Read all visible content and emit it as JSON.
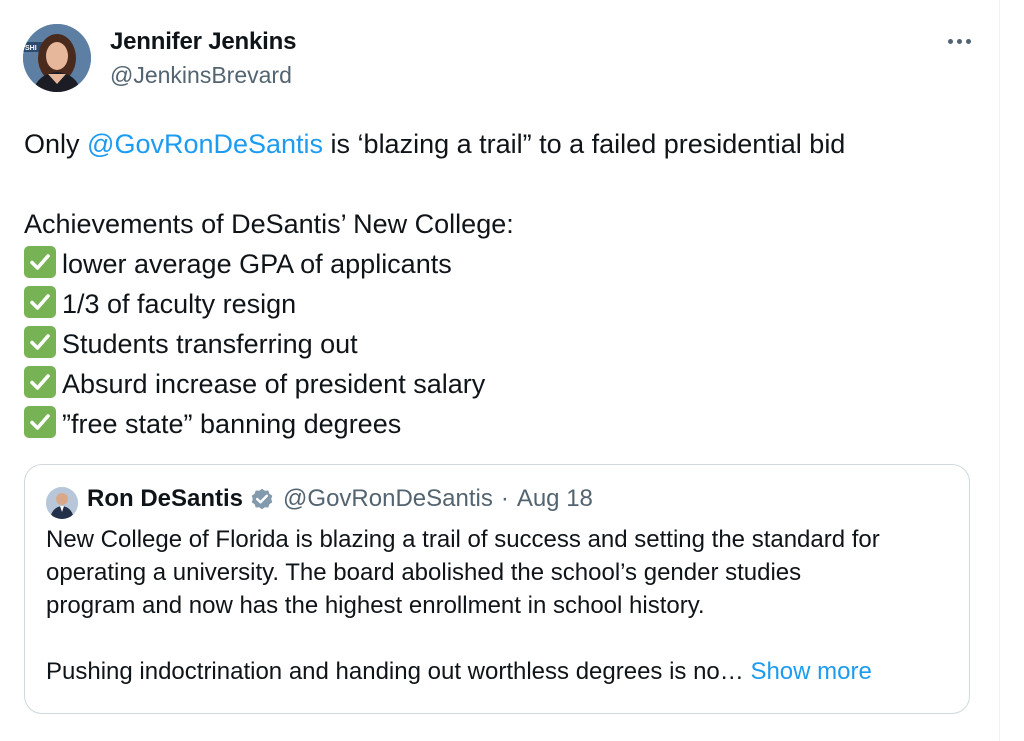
{
  "author": {
    "name": "Jennifer Jenkins",
    "handle": "@JenkinsBrevard",
    "avatar_icon": "profile-photo"
  },
  "more_icon": "ellipsis-icon",
  "tweet": {
    "line1_prefix": "Only ",
    "line1_mention": "@GovRonDeSantis",
    "line1_suffix": " is ‘blazing a trail” to a failed presidential bid",
    "heading": "Achievements of DeSantis’ New College:",
    "items": [
      "lower average GPA of applicants",
      "1/3 of faculty resign",
      "Students transferring out",
      "Absurd increase of president salary",
      "”free state” banning degrees"
    ],
    "check_icon": "check-mark-button-emoji",
    "check_color": "#77b255"
  },
  "quote": {
    "name": "Ron DeSantis",
    "verified_icon": "verified-badge-icon",
    "handle": "@GovRonDeSantis",
    "separator": "·",
    "date": "Aug 18",
    "lines": [
      "New College of Florida is blazing a trail of success and setting the standard for",
      "operating a university. The board abolished the school’s gender studies",
      "program and now has the highest enrollment in school history."
    ],
    "last_line": "Pushing indoctrination and handing out worthless degrees is no…",
    "show_more": "Show more"
  },
  "colors": {
    "link": "#1d9bf0",
    "secondary_text": "#536471",
    "border": "#cfd9de",
    "verified_gray": "#829aab"
  }
}
